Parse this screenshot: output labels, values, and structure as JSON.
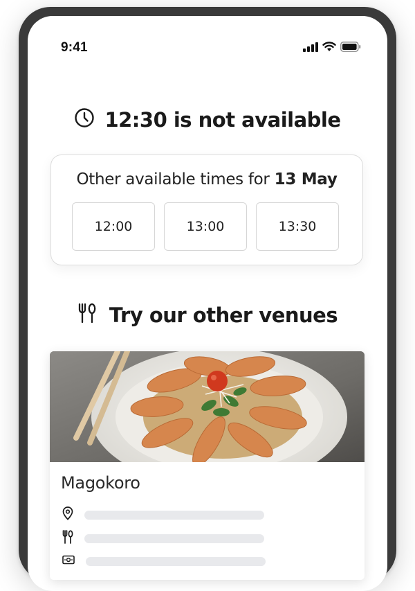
{
  "status_bar": {
    "time": "9:41",
    "icons": [
      "signal-icon",
      "wifi-icon",
      "battery-icon"
    ]
  },
  "unavailable": {
    "icon": "clock-icon",
    "title": "12:30 is not available"
  },
  "alternatives": {
    "heading_prefix": "Other available times for ",
    "date": "13 May",
    "slots": [
      "12:00",
      "13:00",
      "13:30"
    ]
  },
  "venues": {
    "icon": "cutlery-icon",
    "title": "Try our other venues",
    "items": [
      {
        "name": "Magokoro",
        "photo": "sashimi-plate-image",
        "detail_icons": [
          "location-pin-icon",
          "cutlery-icon",
          "money-icon"
        ]
      }
    ]
  },
  "colors": {
    "text_primary": "#1a1a1a",
    "border": "#dcdcdc",
    "skeleton": "#e8e9ec",
    "phone_frame": "#3a3a3a"
  }
}
